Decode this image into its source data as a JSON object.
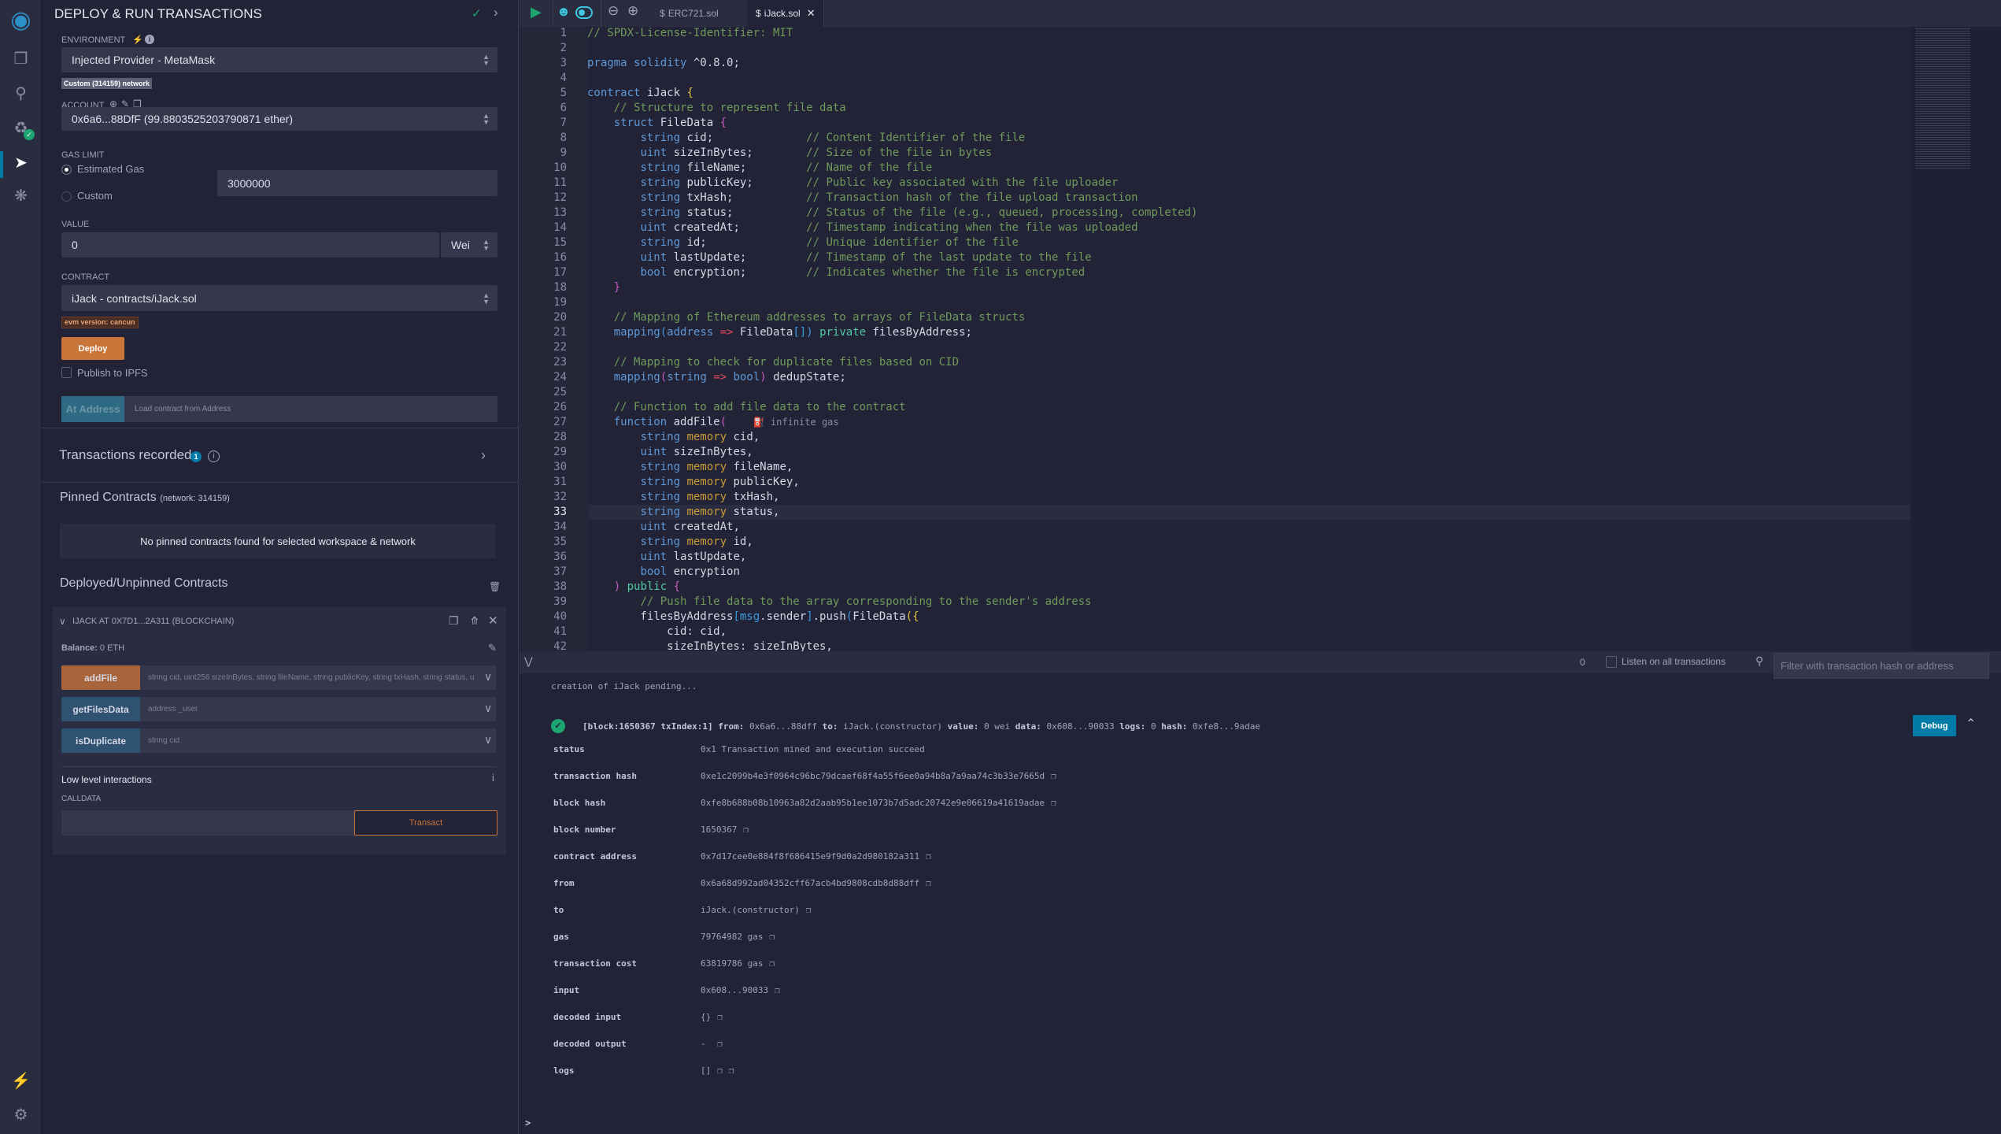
{
  "iconbar": {
    "items": [
      "logo-icon",
      "files-icon",
      "search-icon",
      "git-icon",
      "deploy-icon",
      "debug-icon"
    ],
    "bottom": [
      "plugin-icon",
      "settings-icon"
    ]
  },
  "panel": {
    "title": "DEPLOY & RUN TRANSACTIONS",
    "environment_label": "ENVIRONMENT",
    "environment_value": "Injected Provider - MetaMask",
    "network_badge": "Custom (314159) network",
    "account_label": "ACCOUNT",
    "account_value": "0x6a6...88DfF (99.8803525203790871 ether)",
    "gas_limit_label": "GAS LIMIT",
    "estimated_gas": "Estimated Gas",
    "custom": "Custom",
    "custom_gas_value": "3000000",
    "value_label": "VALUE",
    "value": "0",
    "value_unit": "Wei",
    "contract_label": "CONTRACT",
    "contract_value": "iJack - contracts/iJack.sol",
    "evm_badge": "evm version: cancun",
    "deploy": "Deploy",
    "publish_ipfs": "Publish to IPFS",
    "at_address": "At Address",
    "at_address_placeholder": "Load contract from Address",
    "transactions_recorded": "Transactions recorded",
    "transactions_count": "1",
    "pinned_title": "Pinned Contracts",
    "pinned_network": "(network: 314159)",
    "pinned_empty": "No pinned contracts found for selected workspace & network",
    "deployed_title": "Deployed/Unpinned Contracts",
    "instance_title": "IJACK AT 0X7D1...2A311 (BLOCKCHAIN)",
    "balance_label": "Balance:",
    "balance_value": "0 ETH",
    "functions": [
      {
        "name": "addFile",
        "params": "string cid, uint256 sizeInBytes, string fileName, string publicKey, string txHash, string status, u",
        "color": "#a8643a"
      },
      {
        "name": "getFilesData",
        "params": "address _user",
        "color": "#2f5270"
      },
      {
        "name": "isDuplicate",
        "params": "string cid",
        "color": "#2f5270"
      }
    ],
    "low_level": "Low level interactions",
    "calldata_label": "CALLDATA",
    "transact": "Transact"
  },
  "editor": {
    "tabs": [
      {
        "label": "ERC721.sol",
        "active": false
      },
      {
        "label": "iJack.sol",
        "active": true
      }
    ],
    "current_line": 33,
    "lines": [
      [
        [
          "// SPDX-License-Identifier: MIT",
          "c"
        ]
      ],
      [],
      [
        [
          "pragma",
          "k"
        ],
        [
          " "
        ],
        [
          "solidity",
          "k"
        ],
        [
          " ^0.8.0;"
        ]
      ],
      [],
      [
        [
          "contract",
          "k"
        ],
        [
          " iJack "
        ],
        [
          "{",
          "y"
        ]
      ],
      [
        [
          "    "
        ],
        [
          "// Structure to represent file data",
          "c"
        ]
      ],
      [
        [
          "    "
        ],
        [
          "struct",
          "k"
        ],
        [
          " FileData "
        ],
        [
          "{",
          "pk"
        ]
      ],
      [
        [
          "        "
        ],
        [
          "string",
          "t"
        ],
        [
          " cid;              "
        ],
        [
          "// Content Identifier of the file",
          "c"
        ]
      ],
      [
        [
          "        "
        ],
        [
          "uint",
          "t"
        ],
        [
          " sizeInBytes;        "
        ],
        [
          "// Size of the file in bytes",
          "c"
        ]
      ],
      [
        [
          "        "
        ],
        [
          "string",
          "t"
        ],
        [
          " fileName;         "
        ],
        [
          "// Name of the file",
          "c"
        ]
      ],
      [
        [
          "        "
        ],
        [
          "string",
          "t"
        ],
        [
          " publicKey;        "
        ],
        [
          "// Public key associated with the file uploader",
          "c"
        ]
      ],
      [
        [
          "        "
        ],
        [
          "string",
          "t"
        ],
        [
          " txHash;           "
        ],
        [
          "// Transaction hash of the file upload transaction",
          "c"
        ]
      ],
      [
        [
          "        "
        ],
        [
          "string",
          "t"
        ],
        [
          " status;           "
        ],
        [
          "// Status of the file (e.g., queued, processing, completed)",
          "c"
        ]
      ],
      [
        [
          "        "
        ],
        [
          "uint",
          "t"
        ],
        [
          " createdAt;          "
        ],
        [
          "// Timestamp indicating when the file was uploaded",
          "c"
        ]
      ],
      [
        [
          "        "
        ],
        [
          "string",
          "t"
        ],
        [
          " id;               "
        ],
        [
          "// Unique identifier of the file",
          "c"
        ]
      ],
      [
        [
          "        "
        ],
        [
          "uint",
          "t"
        ],
        [
          " lastUpdate;         "
        ],
        [
          "// Timestamp of the last update to the file",
          "c"
        ]
      ],
      [
        [
          "        "
        ],
        [
          "bool",
          "t"
        ],
        [
          " encryption;         "
        ],
        [
          "// Indicates whether the file is encrypted",
          "c"
        ]
      ],
      [
        [
          "    "
        ],
        [
          "}",
          "pk"
        ]
      ],
      [],
      [
        [
          "    "
        ],
        [
          "// Mapping of Ethereum addresses to arrays of FileData structs",
          "c"
        ]
      ],
      [
        [
          "    "
        ],
        [
          "mapping",
          "k"
        ],
        [
          "(",
          "bl"
        ],
        [
          "address",
          "t"
        ],
        [
          " "
        ],
        [
          "=>",
          "o"
        ],
        [
          " FileData"
        ],
        [
          "[])",
          "bl"
        ],
        [
          " "
        ],
        [
          "private",
          "p"
        ],
        [
          " filesByAddress;"
        ]
      ],
      [],
      [
        [
          "    "
        ],
        [
          "// Mapping to check for duplicate files based on CID",
          "c"
        ]
      ],
      [
        [
          "    "
        ],
        [
          "mapping",
          "k"
        ],
        [
          "(",
          "pk"
        ],
        [
          "string",
          "t"
        ],
        [
          " "
        ],
        [
          "=>",
          "o"
        ],
        [
          " "
        ],
        [
          "bool",
          "t"
        ],
        [
          ")",
          "pk"
        ],
        [
          " dedupState;"
        ]
      ],
      [],
      [
        [
          "    "
        ],
        [
          "// Function to add file data to the contract",
          "c"
        ]
      ],
      [
        [
          "    "
        ],
        [
          "function",
          "k"
        ],
        [
          " addFile"
        ],
        [
          "(",
          "pk"
        ],
        [
          "    "
        ],
        [
          "⛽ infinite gas",
          "g"
        ]
      ],
      [
        [
          "        "
        ],
        [
          "string",
          "t"
        ],
        [
          " "
        ],
        [
          "memory",
          "m"
        ],
        [
          " cid,"
        ]
      ],
      [
        [
          "        "
        ],
        [
          "uint",
          "t"
        ],
        [
          " sizeInBytes,"
        ]
      ],
      [
        [
          "        "
        ],
        [
          "string",
          "t"
        ],
        [
          " "
        ],
        [
          "memory",
          "m"
        ],
        [
          " fileName,"
        ]
      ],
      [
        [
          "        "
        ],
        [
          "string",
          "t"
        ],
        [
          " "
        ],
        [
          "memory",
          "m"
        ],
        [
          " publicKey,"
        ]
      ],
      [
        [
          "        "
        ],
        [
          "string",
          "t"
        ],
        [
          " "
        ],
        [
          "memory",
          "m"
        ],
        [
          " txHash,"
        ]
      ],
      [
        [
          "        "
        ],
        [
          "string",
          "t"
        ],
        [
          " "
        ],
        [
          "memory",
          "m"
        ],
        [
          " status,"
        ]
      ],
      [
        [
          "        "
        ],
        [
          "uint",
          "t"
        ],
        [
          " createdAt,"
        ]
      ],
      [
        [
          "        "
        ],
        [
          "string",
          "t"
        ],
        [
          " "
        ],
        [
          "memory",
          "m"
        ],
        [
          " id,"
        ]
      ],
      [
        [
          "        "
        ],
        [
          "uint",
          "t"
        ],
        [
          " lastUpdate,"
        ]
      ],
      [
        [
          "        "
        ],
        [
          "bool",
          "t"
        ],
        [
          " encryption"
        ]
      ],
      [
        [
          "    "
        ],
        [
          ")",
          "pk"
        ],
        [
          " "
        ],
        [
          "public",
          "p"
        ],
        [
          " "
        ],
        [
          "{",
          "pk"
        ]
      ],
      [
        [
          "        "
        ],
        [
          "// Push file data to the array corresponding to the sender's address",
          "c"
        ]
      ],
      [
        [
          "        filesByAddress"
        ],
        [
          "[",
          "bl"
        ],
        [
          "msg",
          "bl"
        ],
        [
          ".sender"
        ],
        [
          "]",
          "bl"
        ],
        [
          ".push"
        ],
        [
          "(",
          "bl"
        ],
        [
          "FileData"
        ],
        [
          "({",
          "y"
        ]
      ],
      [
        [
          "            cid: cid,"
        ]
      ],
      [
        [
          "            sizeInBytes: sizeInBytes,"
        ]
      ]
    ]
  },
  "terminal": {
    "counter": "0",
    "listen_label": "Listen on all transactions",
    "filter_placeholder": "Filter with transaction hash or address",
    "pending": "creation of iJack pending...",
    "tx_header": [
      [
        "[block:1650367 txIndex:1]",
        "b"
      ],
      [
        " from:",
        "b"
      ],
      [
        " 0x6a6...88dff "
      ],
      [
        "to:",
        "b"
      ],
      [
        " iJack.(constructor) "
      ],
      [
        "value:",
        "b"
      ],
      [
        " 0 wei "
      ],
      [
        "data:",
        "b"
      ],
      [
        " 0x608...90033 "
      ],
      [
        "logs:",
        "b"
      ],
      [
        " 0 "
      ],
      [
        "hash:",
        "b"
      ],
      [
        " 0xfe8...9adae"
      ]
    ],
    "debug": "Debug",
    "rows": [
      {
        "k": "status",
        "v": "0x1 Transaction mined and execution succeed",
        "copy": 0
      },
      {
        "k": "transaction hash",
        "v": "0xe1c2099b4e3f0964c96bc79dcaef68f4a55f6ee0a94b8a7a9aa74c3b33e7665d",
        "copy": 1
      },
      {
        "k": "block hash",
        "v": "0xfe8b688b08b10963a82d2aab95b1ee1073b7d5adc20742e9e06619a41619adae",
        "copy": 1
      },
      {
        "k": "block number",
        "v": "1650367",
        "copy": 1
      },
      {
        "k": "contract address",
        "v": "0x7d17cee0e884f8f686415e9f9d0a2d980182a311",
        "copy": 1
      },
      {
        "k": "from",
        "v": "0x6a68d992ad04352cff67acb4bd9808cdb8d88dff",
        "copy": 1
      },
      {
        "k": "to",
        "v": "iJack.(constructor)",
        "copy": 1
      },
      {
        "k": "gas",
        "v": "79764982 gas",
        "copy": 1
      },
      {
        "k": "transaction cost",
        "v": "63819786 gas",
        "copy": 1
      },
      {
        "k": "input",
        "v": "0x608...90033",
        "copy": 1
      },
      {
        "k": "decoded input",
        "v": "{}",
        "copy": 1
      },
      {
        "k": "decoded output",
        "v": " - ",
        "copy": 1
      },
      {
        "k": "logs",
        "v": "[]",
        "copy": 2
      }
    ],
    "prompt": ">"
  },
  "colors": {
    "accent": "#007aa6",
    "deploy": "#c97539",
    "success": "#1ea672"
  }
}
